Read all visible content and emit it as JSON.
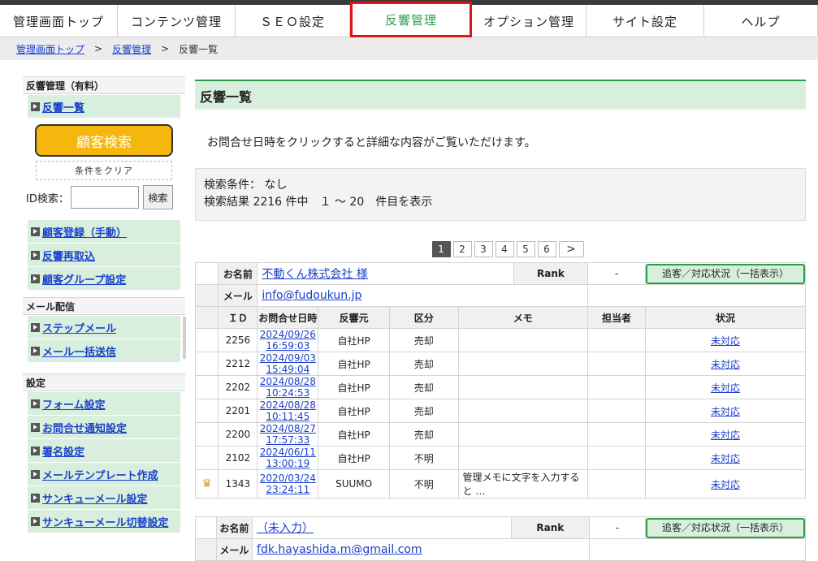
{
  "nav": {
    "items": [
      {
        "label": "管理画面トップ",
        "w": 145
      },
      {
        "label": "コンテンツ管理",
        "w": 145
      },
      {
        "label": "ＳＥＯ設定",
        "w": 141
      },
      {
        "label": "反響管理",
        "w": 150
      },
      {
        "label": "オプション管理",
        "w": 141
      },
      {
        "label": "サイト設定",
        "w": 145
      },
      {
        "label": "ヘルプ",
        "w": 140
      }
    ]
  },
  "breadcrumb": {
    "home": "管理画面トップ",
    "sep": ">",
    "section": "反響管理",
    "current": "反響一覧"
  },
  "sidebar": {
    "group1_title": "反響管理（有料）",
    "list_link": "反響一覧",
    "search_button": "顧客検索",
    "clear_button": "条件をクリア",
    "id_label": "ID検索：",
    "id_search_button": "検索",
    "group1_items": [
      "顧客登録（手動）",
      "反響再取込",
      "顧客グループ設定"
    ],
    "group2_title": "メール配信",
    "group2_items": [
      "ステップメール",
      "メール一括送信"
    ],
    "group3_title": "設定",
    "group3_items": [
      "フォーム設定",
      "お問合せ通知設定",
      "署名設定",
      "メールテンプレート作成",
      "サンキューメール設定",
      "サンキューメール切替設定"
    ]
  },
  "main": {
    "title": "反響一覧",
    "notice": "お問合せ日時をクリックすると詳細な内容がご覧いただけます。",
    "cond_line1": "検索条件： なし",
    "cond_line2": "検索結果 2216 件中　１ ～ 20　件目を表示",
    "pages": [
      "1",
      "2",
      "3",
      "4",
      "5",
      "6"
    ],
    "next": ">"
  },
  "labels": {
    "name": "お名前",
    "mail": "メール",
    "rank": "Rank",
    "track": "追客／対応状況（一括表示）",
    "cols": [
      "ＩＤ",
      "お問合せ日時",
      "反響元",
      "区分",
      "メモ",
      "担当者",
      "状況"
    ]
  },
  "customers": [
    {
      "name": "不動くん株式会社 様",
      "rank": "-",
      "mail": "info@fudoukun.jp",
      "rows": [
        {
          "id": "2256",
          "date": "2024/09/26 16:59:03",
          "src": "自社HP",
          "kind": "売却",
          "memo": "",
          "staff": "",
          "status": "未対応",
          "crown": ""
        },
        {
          "id": "2212",
          "date": "2024/09/03 15:49:04",
          "src": "自社HP",
          "kind": "売却",
          "memo": "",
          "staff": "",
          "status": "未対応",
          "crown": ""
        },
        {
          "id": "2202",
          "date": "2024/08/28 10:24:53",
          "src": "自社HP",
          "kind": "売却",
          "memo": "",
          "staff": "",
          "status": "未対応",
          "crown": ""
        },
        {
          "id": "2201",
          "date": "2024/08/28 10:11:45",
          "src": "自社HP",
          "kind": "売却",
          "memo": "",
          "staff": "",
          "status": "未対応",
          "crown": ""
        },
        {
          "id": "2200",
          "date": "2024/08/27 17:57:33",
          "src": "自社HP",
          "kind": "売却",
          "memo": "",
          "staff": "",
          "status": "未対応",
          "crown": ""
        },
        {
          "id": "2102",
          "date": "2024/06/11 13:00:19",
          "src": "自社HP",
          "kind": "不明",
          "memo": "",
          "staff": "",
          "status": "未対応",
          "crown": ""
        },
        {
          "id": "1343",
          "date": "2020/03/24 23:24:11",
          "src": "SUUMO",
          "kind": "不明",
          "memo": "管理メモに文字を入力すると …",
          "staff": "",
          "status": "未対応",
          "crown": "♛"
        }
      ]
    },
    {
      "name": "（未入力）",
      "rank": "-",
      "mail": "fdk.hayashida.m@gmail.com",
      "rows": []
    }
  ]
}
